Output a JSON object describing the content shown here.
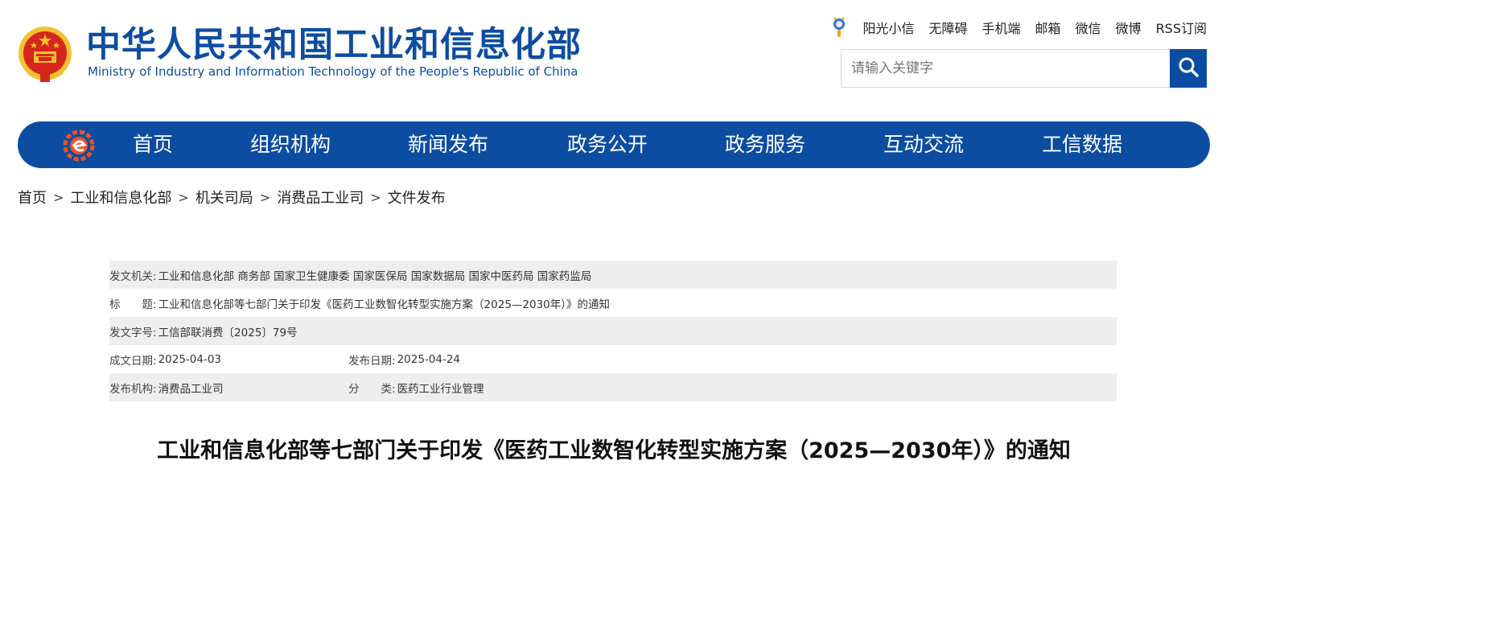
{
  "site": {
    "title": "中华人民共和国工业和信息化部",
    "subtitle": "Ministry of Industry and Information Technology of the People's Republic of China"
  },
  "toplinks": [
    "阳光小信",
    "无障碍",
    "手机端",
    "邮箱",
    "微信",
    "微博",
    "RSS订阅"
  ],
  "search": {
    "placeholder": "请输入关键字"
  },
  "nav": {
    "items": [
      "首页",
      "组织机构",
      "新闻发布",
      "政务公开",
      "政务服务",
      "互动交流",
      "工信数据"
    ]
  },
  "breadcrumb": [
    "首页",
    "工业和信息化部",
    "机关司局",
    "消费品工业司",
    "文件发布"
  ],
  "breadcrumb_separator": ">",
  "info": {
    "issuer_label": "发文机关:",
    "issuer_value": "工业和信息化部 商务部 国家卫生健康委 国家医保局 国家数据局 国家中医药局 国家药监局",
    "subject_label": "标　　题:",
    "subject_value": "工业和信息化部等七部门关于印发《医药工业数智化转型实施方案（2025—2030年）》的通知",
    "docno_label": "发文字号:",
    "docno_value": "工信部联消费〔2025〕79号",
    "created_label": "成文日期:",
    "created_value": "2025-04-03",
    "published_label": "发布日期:",
    "published_value": "2025-04-24",
    "agency_label": "发布机构:",
    "agency_value": "消费品工业司",
    "category_label": "分　　类:",
    "category_value": "医药工业行业管理"
  },
  "article": {
    "title": "工业和信息化部等七部门关于印发《医药工业数智化转型实施方案（2025—2030年）》的通知"
  },
  "colors": {
    "brand_blue": "#0d4da1",
    "emblem_red": "#d7261e",
    "emblem_gold": "#f2c230",
    "row_shade": "#eeeeee"
  },
  "icons": [
    "national-emblem-icon",
    "sun-icon",
    "search-icon",
    "nav-logo-icon"
  ]
}
